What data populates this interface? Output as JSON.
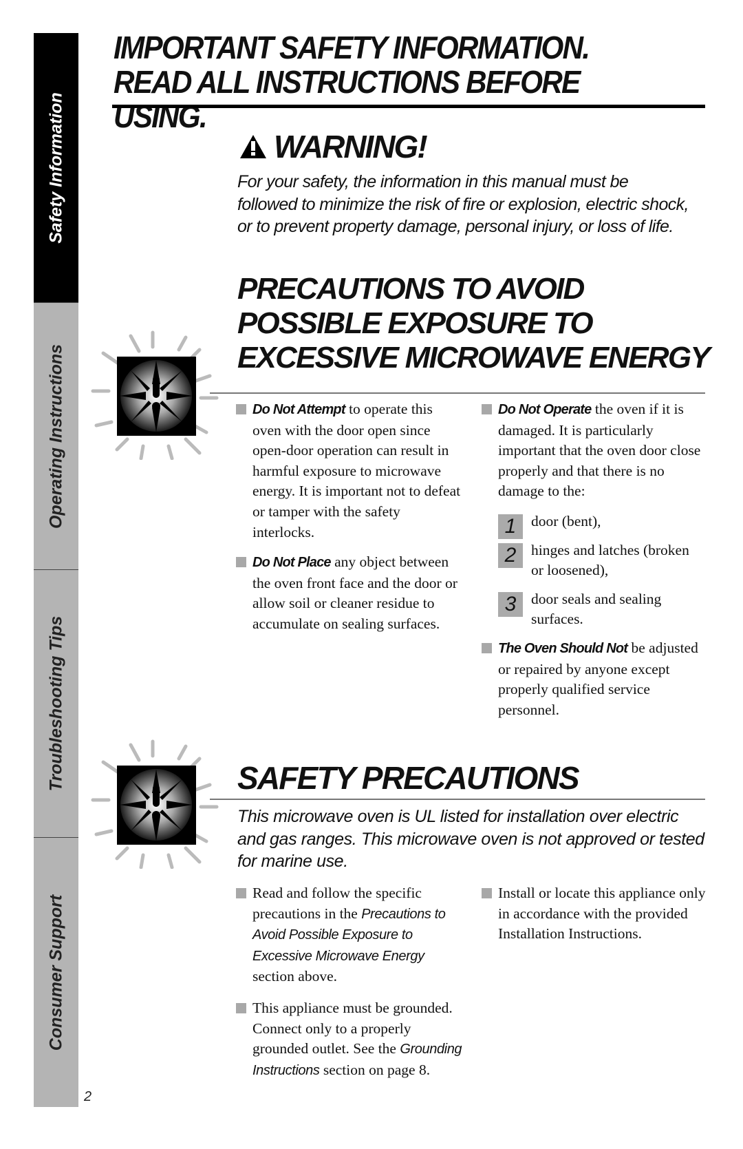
{
  "sidebar": {
    "tabs": [
      {
        "label": "Safety Information",
        "active": true
      },
      {
        "label": "Operating Instructions",
        "active": false
      },
      {
        "label": "Troubleshooting Tips",
        "active": false
      },
      {
        "label": "Consumer Support",
        "active": false
      }
    ]
  },
  "page_number": "2",
  "header": {
    "line1": "IMPORTANT SAFETY INFORMATION.",
    "line2": "READ ALL INSTRUCTIONS BEFORE USING."
  },
  "warning": {
    "icon": "warning-triangle-icon",
    "title": "WARNING!",
    "text": "For your safety, the information in this manual must be followed to minimize the risk of fire or explosion, electric shock, or to prevent property damage, personal injury, or loss of life."
  },
  "precautions": {
    "icon": "alert-burst-icon",
    "title_lines": [
      "PRECAUTIONS TO AVOID",
      "POSSIBLE EXPOSURE TO",
      "EXCESSIVE MICROWAVE ENERGY"
    ],
    "left": [
      {
        "lead": "Do Not Attempt",
        "text": " to operate this oven with the door open since open-door operation can result in harmful exposure to microwave energy. It is important not to defeat or tamper with the safety interlocks."
      },
      {
        "lead": "Do Not Place",
        "text": " any object between the oven front face and the door or allow soil or cleaner residue to accumulate on sealing surfaces."
      }
    ],
    "right": {
      "first": {
        "lead": "Do Not Operate",
        "text": " the oven if it is damaged. It is particularly important that the oven door close properly and that there is no damage to the:"
      },
      "numbered": [
        {
          "num": "1",
          "text": "door (bent),"
        },
        {
          "num": "2",
          "text": "hinges and latches (broken or loosened),"
        },
        {
          "num": "3",
          "text": "door seals and sealing surfaces."
        }
      ],
      "last": {
        "lead": "The Oven Should Not",
        "text": " be adjusted or repaired by anyone except properly qualified service personnel."
      }
    }
  },
  "safety": {
    "icon": "alert-burst-icon",
    "title": "SAFETY PRECAUTIONS",
    "intro": "This microwave oven is UL listed for installation over electric and gas ranges. This microwave oven is not approved or tested for marine use.",
    "left": [
      {
        "pre": "Read and follow the specific precautions in the ",
        "ital": "Precautions to Avoid Possible Exposure to Excessive Microwave Energy",
        "post": " section above."
      },
      {
        "pre": "This appliance must be grounded. Connect only to a properly grounded outlet. See the ",
        "ital": "Grounding Instructions",
        "post": " section on page 8."
      }
    ],
    "right": [
      {
        "pre": "Install or locate this appliance only in accordance with the provided Installation Instructions.",
        "ital": "",
        "post": ""
      }
    ]
  }
}
